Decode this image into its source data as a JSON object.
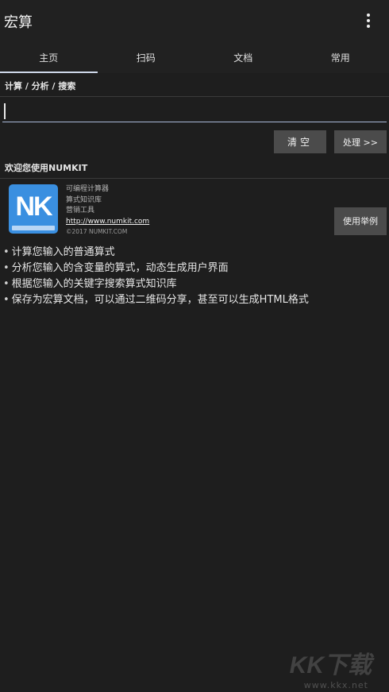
{
  "appbar": {
    "title": "宏算"
  },
  "tabs": [
    {
      "label": "主页",
      "active": true
    },
    {
      "label": "扫码",
      "active": false
    },
    {
      "label": "文档",
      "active": false
    },
    {
      "label": "常用",
      "active": false
    }
  ],
  "calc_section": {
    "header": "计算 / 分析 / 搜索",
    "input_value": "",
    "clear_label": "清空",
    "process_label": "处理 >>"
  },
  "welcome_section": {
    "header": "欢迎您使用NUMKIT",
    "logo_text": "NK",
    "info_lines": [
      "可编程计算器",
      "算式知识库",
      "营销工具"
    ],
    "link": "http://www.numkit.com",
    "copyright": "©2017 NUMKIT.COM",
    "example_label_1": "使用",
    "example_label_2": "举例",
    "features": [
      "计算您输入的普通算式",
      "分析您输入的含变量的算式，动态生成用户界面",
      "根据您输入的关键字搜索算式知识库",
      "保存为宏算文档，可以通过二维码分享，甚至可以生成HTML格式"
    ]
  },
  "watermark": {
    "brand": "KK下载",
    "url": "www.kkx.net"
  },
  "colors": {
    "background": "#1e1e1e",
    "appbar": "#212121",
    "button": "#4b4b4b",
    "logo": "#3a8fe0",
    "tab_indicator": "#cfd8ea"
  },
  "icons": {
    "overflow_menu": "more-vert-icon"
  }
}
